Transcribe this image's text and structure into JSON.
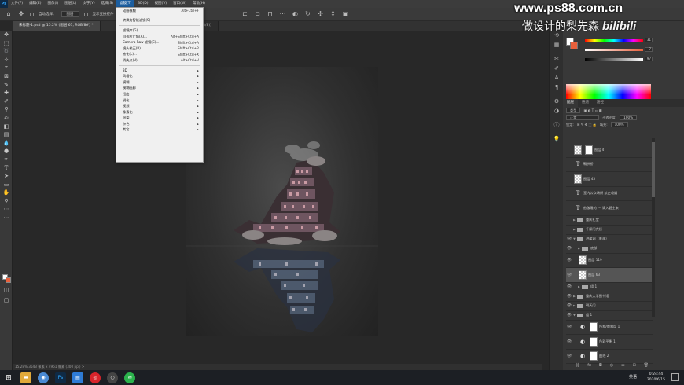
{
  "app": {
    "logo_text": "Ps"
  },
  "menubar": {
    "items": [
      {
        "label": "文件(F)"
      },
      {
        "label": "编辑(E)"
      },
      {
        "label": "图像(I)"
      },
      {
        "label": "图层(L)"
      },
      {
        "label": "文字(Y)"
      },
      {
        "label": "选择(S)"
      },
      {
        "label": "滤镜(T)",
        "active": true
      },
      {
        "label": "3D(D)"
      },
      {
        "label": "视图(V)"
      },
      {
        "label": "窗口(W)"
      },
      {
        "label": "帮助(H)"
      }
    ]
  },
  "options_bar": {
    "auto_select_label": "自动选择：",
    "auto_select_value": "图层",
    "show_transform_label": "显示变换控件"
  },
  "tabs": [
    {
      "label": "未标题-1.psd @ 15.2% (图层 61, RGB/8#) *",
      "active": true
    },
    {
      "label": "... (3.2% (NUGB/8))"
    }
  ],
  "filter_menu": {
    "items": [
      {
        "label": "动感模糊",
        "shortcut": "Alt+Ctrl+F"
      },
      {
        "sep": true
      },
      {
        "label": "转换为智能滤镜(S)",
        "shortcut": ""
      },
      {
        "sep": true
      },
      {
        "label": "滤镜库(G)...",
        "shortcut": ""
      },
      {
        "label": "自适应广角(A)...",
        "shortcut": "Alt+Shift+Ctrl+A"
      },
      {
        "label": "Camera Raw 滤镜(C)...",
        "shortcut": "Shift+Ctrl+A"
      },
      {
        "label": "镜头校正(R)...",
        "shortcut": "Shift+Ctrl+R"
      },
      {
        "label": "液化(L)...",
        "shortcut": "Shift+Ctrl+X"
      },
      {
        "label": "消失点(V)...",
        "shortcut": "Alt+Ctrl+V"
      },
      {
        "sep": true
      },
      {
        "label": "3D",
        "submenu": true
      },
      {
        "label": "风格化",
        "submenu": true
      },
      {
        "label": "模糊",
        "submenu": true
      },
      {
        "label": "模糊画廊",
        "submenu": true
      },
      {
        "label": "扭曲",
        "submenu": true
      },
      {
        "label": "锐化",
        "submenu": true
      },
      {
        "label": "视频",
        "submenu": true
      },
      {
        "label": "像素化",
        "submenu": true
      },
      {
        "label": "渲染",
        "submenu": true
      },
      {
        "label": "杂色",
        "submenu": true
      },
      {
        "label": "其它",
        "submenu": true
      }
    ]
  },
  "status_bar": {
    "text": "15.28%   3543 像素 x 4961 像素 (300 ppi)   >"
  },
  "color_panel": {
    "sliders": [
      {
        "name": "hue",
        "value": "31"
      },
      {
        "name": "saturation",
        "value": "7"
      },
      {
        "name": "brightness",
        "value": "97"
      }
    ],
    "foreground": "#ffffff",
    "background": "#e8603c"
  },
  "layers_panel": {
    "tabs": [
      {
        "label": "图层",
        "active": true
      },
      {
        "label": "通道"
      },
      {
        "label": "路径"
      }
    ],
    "kind_filter": "类型",
    "blend_mode": "正常",
    "opacity_label": "不透明度:",
    "opacity_value": "100%",
    "lock_label": "锁定:",
    "fill_label": "填充:",
    "fill_value": "100%",
    "layers": [
      {
        "kind": "pixel2",
        "name": "图层 4"
      },
      {
        "kind": "text",
        "name": "鞘拱桥"
      },
      {
        "kind": "pixel",
        "name": "图层 43"
      },
      {
        "kind": "text",
        "name": "室内公众场所 禁止吸烟"
      },
      {
        "kind": "text",
        "name": "依敬瞻的 --- 请入碧主来"
      },
      {
        "kind": "folder",
        "name": "重庆礼堂"
      },
      {
        "kind": "folder",
        "name": "千厮门大桥"
      },
      {
        "kind": "folder",
        "name": "洪崖洞（景观）",
        "open": true
      },
      {
        "kind": "folder",
        "name": "底部",
        "indent": 1
      },
      {
        "kind": "pixel",
        "name": "图层 119",
        "indent": 1
      },
      {
        "kind": "pixel",
        "name": "图层 63",
        "indent": 1,
        "selected": true
      },
      {
        "kind": "folder",
        "name": "组 1",
        "indent": 1
      },
      {
        "kind": "folder",
        "name": "重庆大学图书馆"
      },
      {
        "kind": "folder",
        "name": "朝天门"
      },
      {
        "kind": "folder",
        "name": "组 1",
        "open": true
      },
      {
        "kind": "adj",
        "name": "色相/饱和度 1",
        "indent": 1
      },
      {
        "kind": "adj",
        "name": "色彩平衡 1",
        "indent": 1
      },
      {
        "kind": "adj",
        "name": "曲线 2",
        "indent": 1
      }
    ]
  },
  "watermark": {
    "url": "www.ps88.com.cn",
    "subtitle": "做设计的梨先森",
    "brand": "bilibili"
  },
  "taskbar": {
    "lang": "英语",
    "time": "0:24:44",
    "date": "2020/6/15"
  }
}
